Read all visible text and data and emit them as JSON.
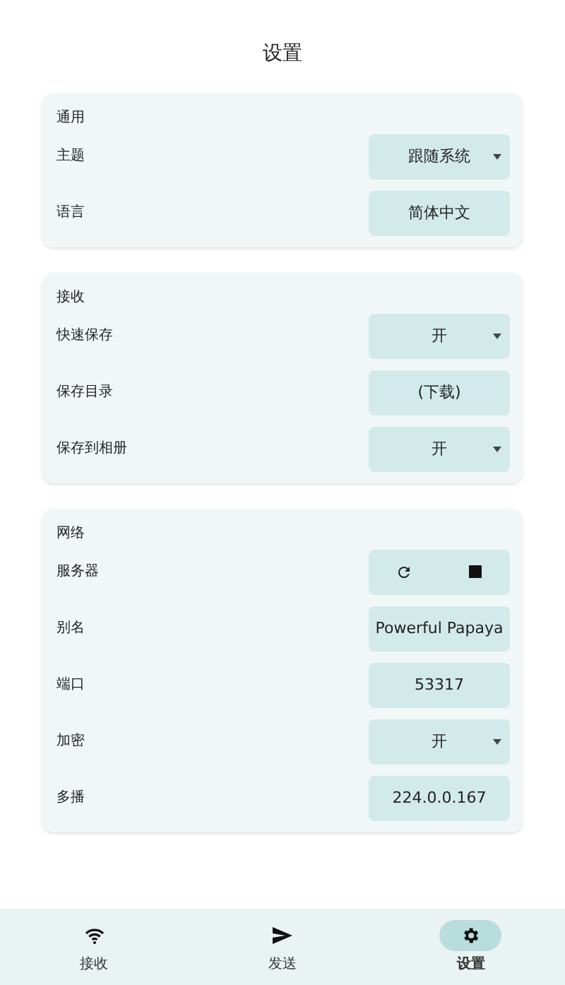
{
  "title": "设置",
  "sections": [
    {
      "title": "通用",
      "rows": [
        {
          "label": "主题",
          "kind": "dropdown",
          "value": "跟随系统"
        },
        {
          "label": "语言",
          "kind": "text",
          "value": "简体中文"
        }
      ]
    },
    {
      "title": "接收",
      "rows": [
        {
          "label": "快速保存",
          "kind": "dropdown",
          "value": "开"
        },
        {
          "label": "保存目录",
          "kind": "text",
          "value": "(下载)"
        },
        {
          "label": "保存到相册",
          "kind": "dropdown",
          "value": "开"
        }
      ]
    },
    {
      "title": "网络",
      "rows": [
        {
          "label": "服务器",
          "kind": "server-controls"
        },
        {
          "label": "别名",
          "kind": "text",
          "value": "Powerful Papaya"
        },
        {
          "label": "端口",
          "kind": "text",
          "value": "53317"
        },
        {
          "label": "加密",
          "kind": "dropdown",
          "value": "开"
        },
        {
          "label": "多播",
          "kind": "text",
          "value": "224.0.0.167"
        }
      ]
    }
  ],
  "nav": [
    {
      "label": "接收",
      "selected": false
    },
    {
      "label": "发送",
      "selected": false
    },
    {
      "label": "设置",
      "selected": true
    }
  ]
}
